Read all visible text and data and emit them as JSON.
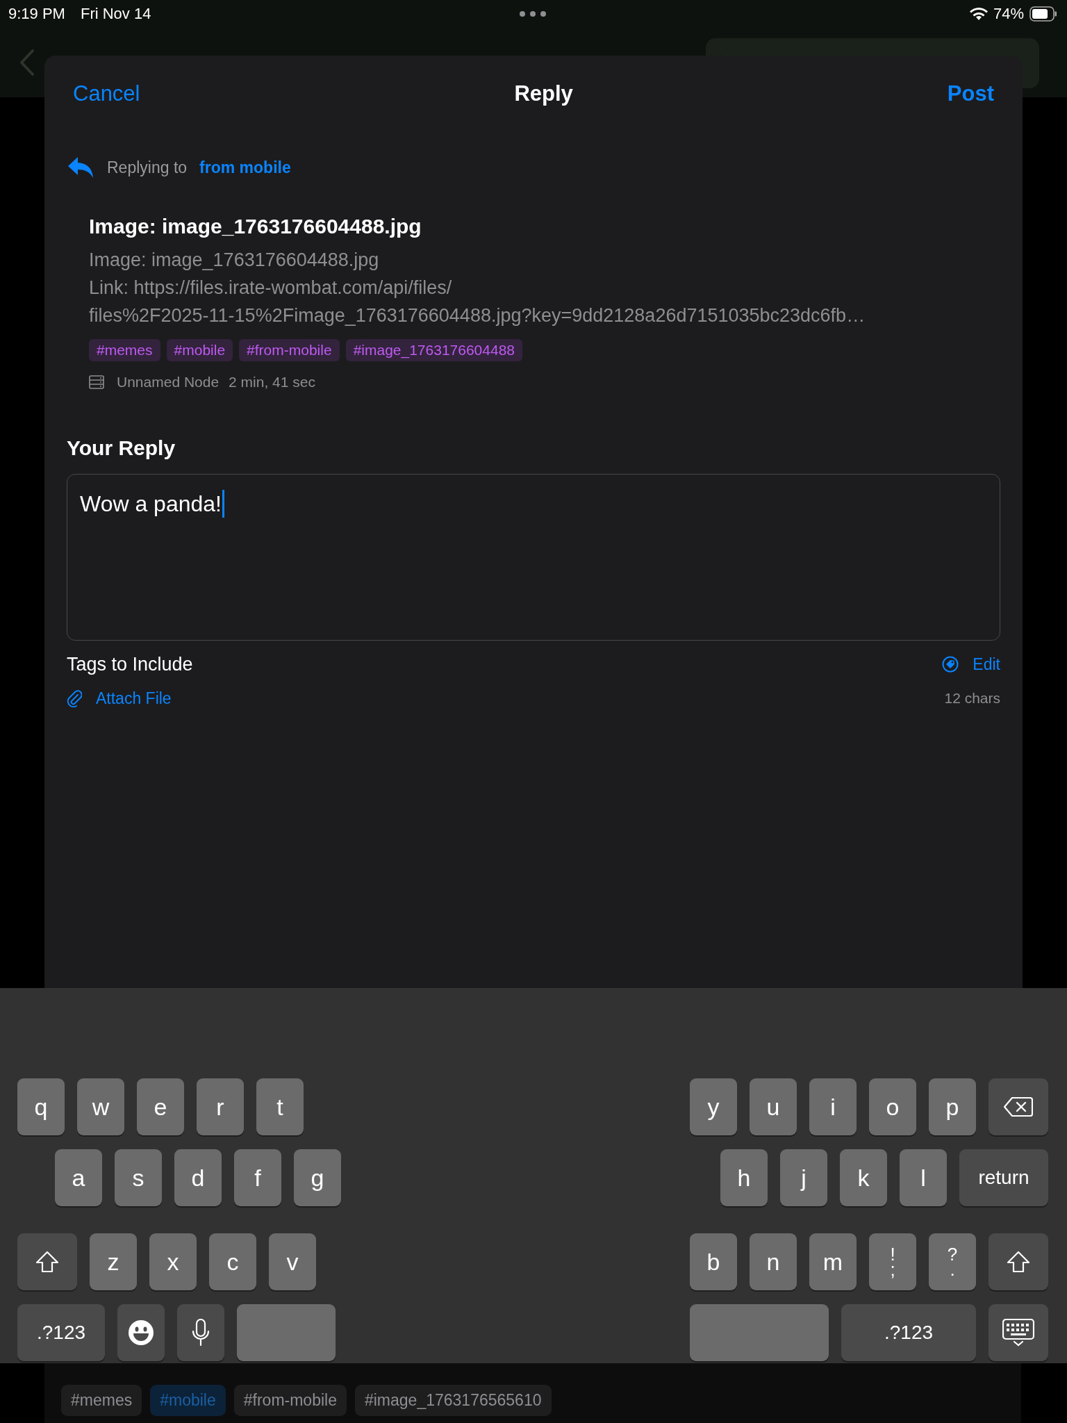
{
  "status_bar": {
    "time": "9:19 PM",
    "date": "Fri Nov 14",
    "battery": "74%"
  },
  "sheet": {
    "cancel": "Cancel",
    "title": "Reply",
    "post": "Post"
  },
  "replying": {
    "label": "Replying to",
    "target": "from mobile"
  },
  "original_post": {
    "title": "Image: image_1763176604488.jpg",
    "body": [
      "Image: image_1763176604488.jpg",
      "Link: https://files.irate-wombat.com/api/files/",
      "files%2F2025-11-15%2Fimage_1763176604488.jpg?key=9dd2128a26d7151035bc23dc6fb…"
    ],
    "tags": [
      "#memes",
      "#mobile",
      "#from-mobile",
      "#image_1763176604488"
    ],
    "node": "Unnamed Node",
    "age": "2 min, 41 sec"
  },
  "reply": {
    "heading": "Your Reply",
    "value": "Wow a panda!"
  },
  "tags_label": "Tags to Include",
  "edit": "Edit",
  "attach": "Attach File",
  "char_count": "12 chars",
  "keyboard": {
    "left": [
      [
        {
          "kind": "letter",
          "label": "q"
        },
        {
          "kind": "letter",
          "label": "w"
        },
        {
          "kind": "letter",
          "label": "e"
        },
        {
          "kind": "letter",
          "label": "r"
        },
        {
          "kind": "letter",
          "label": "t"
        }
      ],
      [
        {
          "kind": "letter",
          "label": "a"
        },
        {
          "kind": "letter",
          "label": "s"
        },
        {
          "kind": "letter",
          "label": "d"
        },
        {
          "kind": "letter",
          "label": "f"
        },
        {
          "kind": "letter",
          "label": "g"
        }
      ],
      [
        {
          "kind": "shift"
        },
        {
          "kind": "letter",
          "label": "z"
        },
        {
          "kind": "letter",
          "label": "x"
        },
        {
          "kind": "letter",
          "label": "c"
        },
        {
          "kind": "letter",
          "label": "v"
        }
      ],
      [
        {
          "kind": "mode",
          "label": ".?123"
        },
        {
          "kind": "emoji"
        },
        {
          "kind": "mic"
        },
        {
          "kind": "space"
        }
      ]
    ],
    "right": [
      [
        {
          "kind": "letter",
          "label": "y"
        },
        {
          "kind": "letter",
          "label": "u"
        },
        {
          "kind": "letter",
          "label": "i"
        },
        {
          "kind": "letter",
          "label": "o"
        },
        {
          "kind": "letter",
          "label": "p"
        },
        {
          "kind": "backspace"
        }
      ],
      [
        {
          "kind": "letter",
          "label": "h"
        },
        {
          "kind": "letter",
          "label": "j"
        },
        {
          "kind": "letter",
          "label": "k"
        },
        {
          "kind": "letter",
          "label": "l"
        },
        {
          "kind": "return",
          "label": "return"
        }
      ],
      [
        {
          "kind": "letter",
          "label": "b"
        },
        {
          "kind": "letter",
          "label": "n"
        },
        {
          "kind": "letter",
          "label": "m"
        },
        {
          "kind": "dual",
          "label": "!",
          "alt": ";"
        },
        {
          "kind": "dual",
          "label": "?",
          "alt": "."
        },
        {
          "kind": "shift"
        }
      ],
      [
        {
          "kind": "space"
        },
        {
          "kind": "mode2",
          "label": ".?123"
        },
        {
          "kind": "hide"
        }
      ]
    ]
  },
  "background_tags": [
    {
      "label": "#memes",
      "selected": false
    },
    {
      "label": "#mobile",
      "selected": true
    },
    {
      "label": "#from-mobile",
      "selected": false
    },
    {
      "label": "#image_1763176565610",
      "selected": false
    }
  ]
}
